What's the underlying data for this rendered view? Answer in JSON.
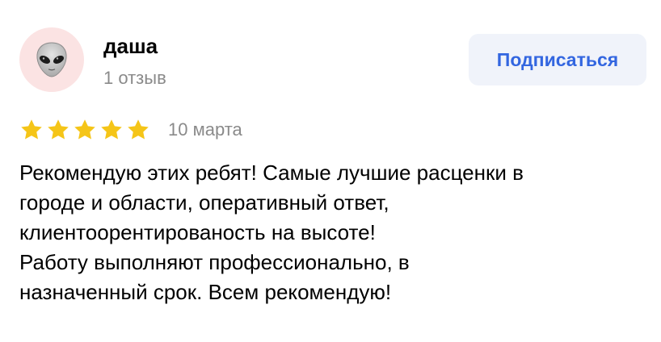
{
  "review": {
    "author": {
      "name": "даша",
      "meta": "1 отзыв",
      "avatar_icon": "alien-face-icon"
    },
    "subscribe_label": "Подписаться",
    "rating": 5,
    "rating_max": 5,
    "date": "10 марта",
    "text_lines": [
      "Рекомендую этих ребят! Самые лучшие расценки в",
      "городе и области, оперативный ответ,",
      "клиентоорентированость на высоте!",
      "Работу выполняют профессионально, в",
      "назначенный срок. Всем рекомендую!"
    ]
  },
  "colors": {
    "star": "#f5c518",
    "accent": "#3366e0",
    "button_bg": "#f0f3fa",
    "avatar_bg": "#fbe3e3",
    "muted_text": "#8a8a8a"
  }
}
